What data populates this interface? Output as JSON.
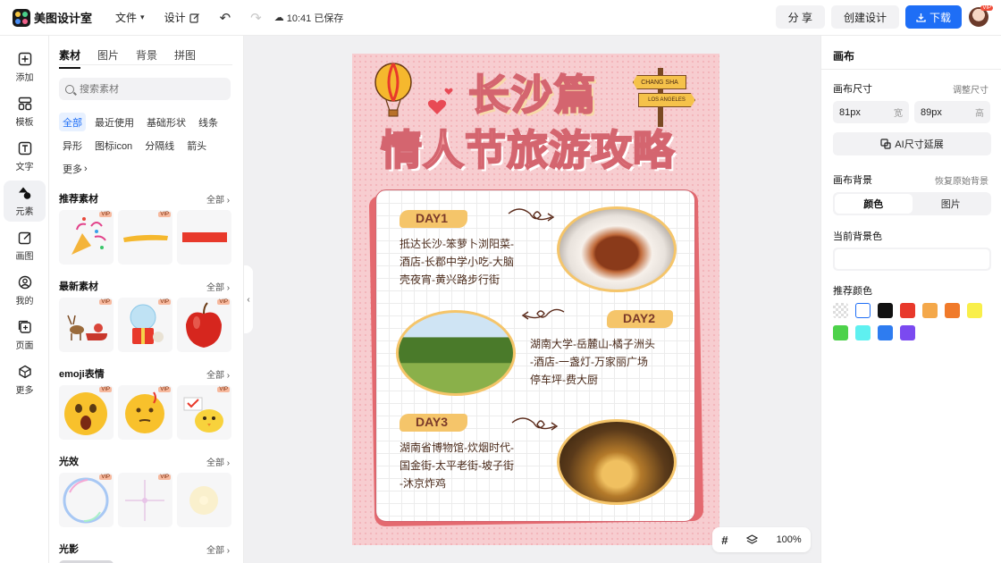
{
  "app": {
    "name": "美图设计室"
  },
  "topbar": {
    "menu_file": "文件",
    "menu_design": "设计",
    "saved_status": "10:41 已保存",
    "share_label": "分 享",
    "create_label": "创建设计",
    "download_label": "下载",
    "vip_badge": "VIP"
  },
  "rail": [
    {
      "label": "添加",
      "icon": "add-icon"
    },
    {
      "label": "模板",
      "icon": "template-icon"
    },
    {
      "label": "文字",
      "icon": "text-icon"
    },
    {
      "label": "元素",
      "icon": "element-icon"
    },
    {
      "label": "画图",
      "icon": "draw-icon"
    },
    {
      "label": "我的",
      "icon": "user-icon"
    },
    {
      "label": "页面",
      "icon": "page-icon"
    },
    {
      "label": "更多",
      "icon": "more-icon"
    }
  ],
  "materials": {
    "tabs": [
      "素材",
      "图片",
      "背景",
      "拼图"
    ],
    "search_placeholder": "搜索素材",
    "chips": [
      "全部",
      "最近使用",
      "基础形状",
      "线条",
      "异形",
      "图标icon",
      "分隔线",
      "箭头",
      "更多"
    ],
    "all_label": "全部",
    "vip": "VIP",
    "sections": [
      "推荐素材",
      "最新素材",
      "emoji表情",
      "光效",
      "光影"
    ]
  },
  "poster": {
    "title_city": "长沙篇",
    "title_main": "情人节旅游攻略",
    "sign_top": "CHANG SHA",
    "sign_bottom": "LOS ANGELES",
    "days": [
      {
        "label": "DAY1",
        "text": [
          "抵达长沙-笨萝卜浏阳菜-",
          "酒店-长郡中学小吃-大脑",
          "壳夜宵-黄兴路步行街"
        ]
      },
      {
        "label": "DAY2",
        "text": [
          "湖南大学-岳麓山-橘子洲头",
          "-酒店-一盏灯-万家丽广场",
          "停车坪-费大厨"
        ]
      },
      {
        "label": "DAY3",
        "text": [
          "湖南省博物馆-炊烟时代-",
          "国金街-太平老街-坡子街",
          "-沐京炸鸡"
        ]
      }
    ]
  },
  "canvas": {
    "zoom": "100%"
  },
  "right_panel": {
    "title": "画布",
    "size_label": "画布尺寸",
    "adjust_link": "调整尺寸",
    "width_value": "81px",
    "width_unit": "宽",
    "height_value": "89px",
    "height_unit": "高",
    "ai_button": "AI尺寸延展",
    "bg_label": "画布背景",
    "restore_link": "恢复原始背景",
    "seg_color": "颜色",
    "seg_image": "图片",
    "current_bg_label": "当前背景色",
    "recommended_label": "推荐颜色",
    "swatches": [
      "transparent",
      "#ffffff",
      "#111111",
      "#e8392b",
      "#f4a84a",
      "#f07a2a",
      "#f9ef4a",
      "#4dd24a",
      "#5ff0f0",
      "#2e7cf0",
      "#7b4af0"
    ]
  },
  "colors": {
    "accent": "#1e6ef6",
    "poster_bg": "#f7cdd0",
    "poster_title": "#f4a1a3",
    "day_badge": "#f5c56a"
  }
}
